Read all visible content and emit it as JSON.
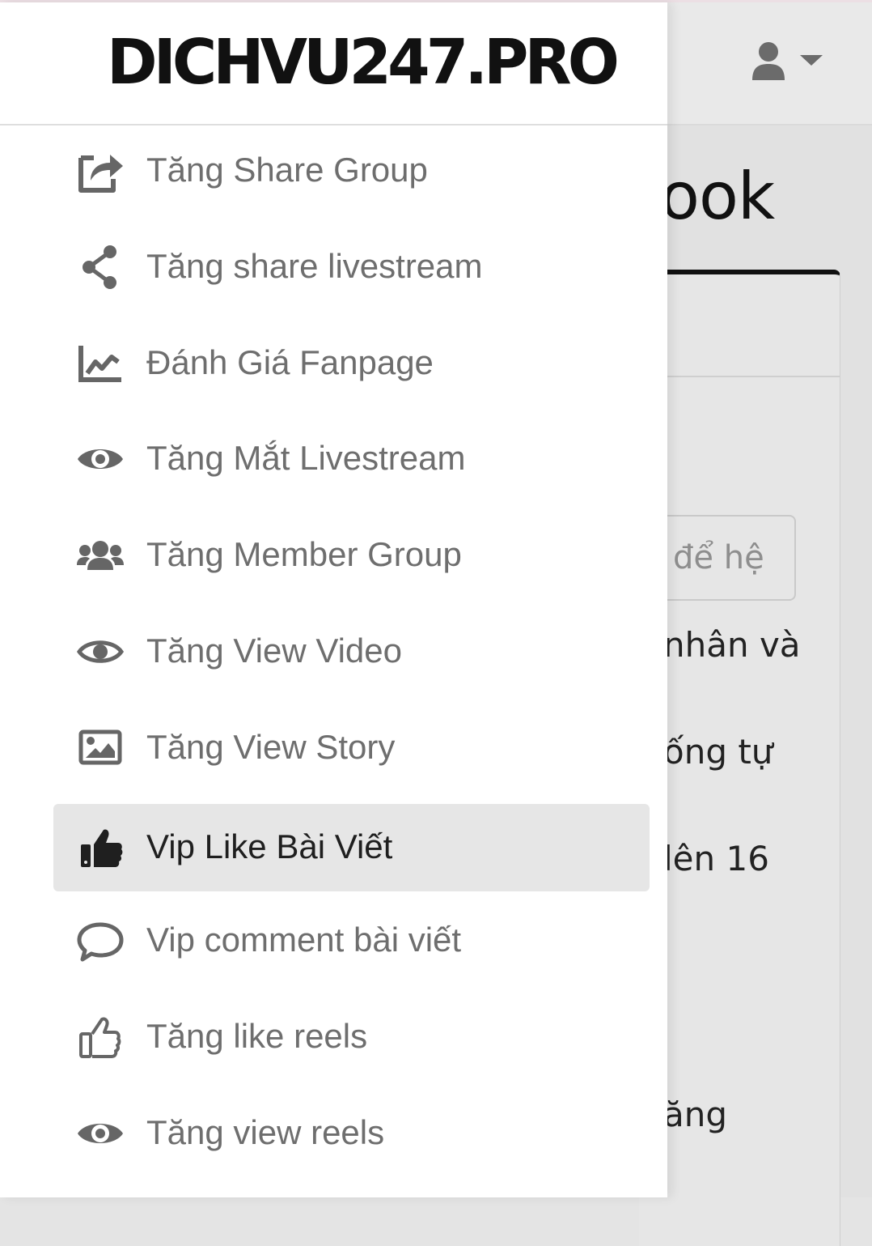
{
  "brand": {
    "logo_text": "DICHVU247.PRO"
  },
  "header": {
    "user_menu_icon": "user-icon",
    "dropdown_icon": "caret-down-icon"
  },
  "background": {
    "page_title_fragment": "ook",
    "input_placeholder_fragment": "để hệ",
    "text_fragments": [
      "nhân và",
      "ống tự",
      "lên 16",
      "ăng"
    ]
  },
  "menu": {
    "items": [
      {
        "label": "Tăng Share Group",
        "icon": "share-square-icon",
        "active": false
      },
      {
        "label": "Tăng share livestream",
        "icon": "share-nodes-icon",
        "active": false
      },
      {
        "label": "Đánh Giá Fanpage",
        "icon": "chart-line-icon",
        "active": false
      },
      {
        "label": "Tăng Mắt Livestream",
        "icon": "eye-icon",
        "active": false
      },
      {
        "label": "Tăng Member Group",
        "icon": "users-icon",
        "active": false
      },
      {
        "label": "Tăng View Video",
        "icon": "eye-outline-icon",
        "active": false
      },
      {
        "label": "Tăng View Story",
        "icon": "image-icon",
        "active": false
      },
      {
        "label": "Vip Like Bài Viết",
        "icon": "thumbs-up-solid-icon",
        "active": true
      },
      {
        "label": "Vip comment bài viết",
        "icon": "comment-icon",
        "active": false
      },
      {
        "label": "Tăng like reels",
        "icon": "thumbs-up-outline-icon",
        "active": false
      },
      {
        "label": "Tăng view reels",
        "icon": "eye-icon",
        "active": false
      }
    ]
  },
  "colors": {
    "menu_text": "#6e6e6e",
    "active_text": "#1f1f1f",
    "active_bg": "#e6e6e6",
    "icon": "#666666"
  }
}
